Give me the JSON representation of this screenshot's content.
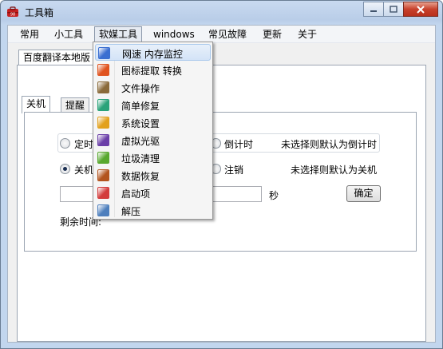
{
  "window": {
    "title": "工具箱"
  },
  "menubar": [
    "常用",
    "小工具",
    "软媒工具",
    "windows",
    "常见故障",
    "更新",
    "关于"
  ],
  "top_tab": "百度翻译本地版",
  "inner_tabs": [
    "关机",
    "提醒"
  ],
  "shutdown": {
    "timer_radio": "定时",
    "countdown_radio": "倒计时",
    "timer_hint": "未选择则默认为倒计时",
    "shutdown_radio": "关机",
    "logout_radio": "注销",
    "action_hint": "未选择则默认为关机",
    "seconds_unit": "秒",
    "confirm_button": "确定",
    "remaining_label": "剩余时间:"
  },
  "dropdown": {
    "items": [
      {
        "label": "网速 内存监控",
        "icon": "network-memory-icon",
        "color": "#3b6fd1"
      },
      {
        "label": "图标提取 转换",
        "icon": "icon-extract-icon",
        "color": "#e0531f"
      },
      {
        "label": "文件操作",
        "icon": "file-ops-icon",
        "color": "#8a6a3a"
      },
      {
        "label": "简单修复",
        "icon": "repair-icon",
        "color": "#2aa37a"
      },
      {
        "label": "系统设置",
        "icon": "settings-gear-icon",
        "color": "#e2a11c"
      },
      {
        "label": "虚拟光驱",
        "icon": "virtual-drive-icon",
        "color": "#6b3fa8"
      },
      {
        "label": "垃圾清理",
        "icon": "cleanup-icon",
        "color": "#58a82e"
      },
      {
        "label": "数据恢复",
        "icon": "data-recovery-icon",
        "color": "#b3541e"
      },
      {
        "label": "启动项",
        "icon": "startup-rocket-icon",
        "color": "#d33b3b"
      },
      {
        "label": "解压",
        "icon": "unzip-icon",
        "color": "#4e7fbd"
      }
    ]
  }
}
